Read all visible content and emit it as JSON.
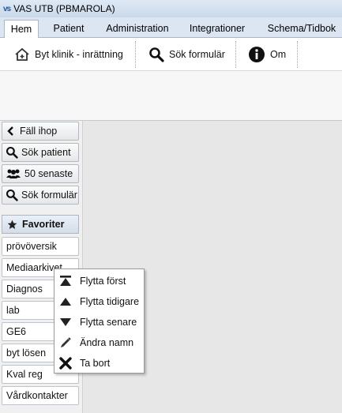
{
  "window": {
    "title": "VAS UTB (PBMAROLA)",
    "app_icon_text": "vs"
  },
  "menu": {
    "tabs": [
      {
        "label": "Hem",
        "active": true
      },
      {
        "label": "Patient"
      },
      {
        "label": "Administration"
      },
      {
        "label": "Integrationer"
      },
      {
        "label": "Schema/Tidbok"
      }
    ]
  },
  "toolbar": {
    "switch_clinic_label": "Byt klinik - inrättning",
    "search_form_label": "Sök formulär",
    "about_label": "Om"
  },
  "sidebar": {
    "collapse_label": "Fäll ihop",
    "search_patient_label": "Sök patient",
    "recent_label": "50 senaste",
    "search_form_label": "Sök formulär",
    "favorites_header": "Favoriter",
    "favorites": [
      "prövöversik",
      "Mediaarkivet",
      "Diagnos",
      "lab",
      "GE6",
      "byt lösen",
      "Kval reg",
      "Vårdkontakter"
    ]
  },
  "context_menu": {
    "items": [
      {
        "label": "Flytta först",
        "icon": "move-first-icon"
      },
      {
        "label": "Flytta tidigare",
        "icon": "move-up-icon"
      },
      {
        "label": "Flytta senare",
        "icon": "move-down-icon"
      },
      {
        "label": "Ändra namn",
        "icon": "pencil-icon"
      },
      {
        "label": "Ta bort",
        "icon": "delete-x-icon"
      }
    ]
  }
}
